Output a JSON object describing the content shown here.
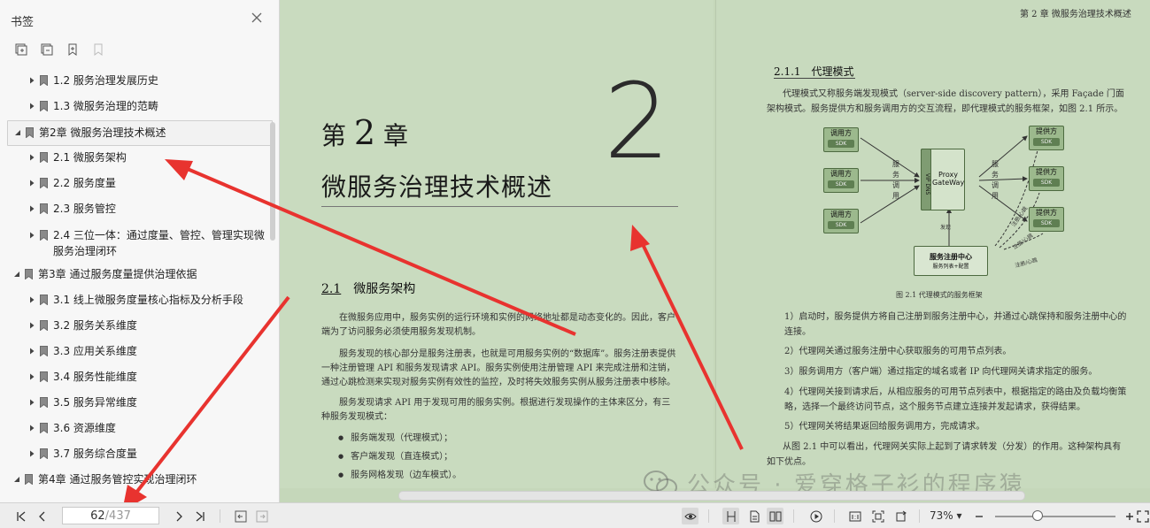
{
  "panel": {
    "title": "书签",
    "items": [
      {
        "label": "1.2  服务治理发展历史",
        "level": 1,
        "expanded": false
      },
      {
        "label": "1.3  微服务治理的范畴",
        "level": 1,
        "expanded": false
      },
      {
        "label": "第2章  微服务治理技术概述",
        "level": 0,
        "expanded": true
      },
      {
        "label": "2.1  微服务架构",
        "level": 1,
        "expanded": false
      },
      {
        "label": "2.2  服务度量",
        "level": 1,
        "expanded": false
      },
      {
        "label": "2.3  服务管控",
        "level": 1,
        "expanded": false
      },
      {
        "label": "2.4  三位一体：通过度量、管控、管理实现微服务治理闭环",
        "level": 1,
        "expanded": false
      },
      {
        "label": "第3章  通过服务度量提供治理依据",
        "level": 0,
        "expanded": true
      },
      {
        "label": "3.1  线上微服务度量核心指标及分析手段",
        "level": 1,
        "expanded": false
      },
      {
        "label": "3.2  服务关系维度",
        "level": 1,
        "expanded": false
      },
      {
        "label": "3.3  应用关系维度",
        "level": 1,
        "expanded": false
      },
      {
        "label": "3.4  服务性能维度",
        "level": 1,
        "expanded": false
      },
      {
        "label": "3.5  服务异常维度",
        "level": 1,
        "expanded": false
      },
      {
        "label": "3.6  资源维度",
        "level": 1,
        "expanded": false
      },
      {
        "label": "3.7  服务综合度量",
        "level": 1,
        "expanded": false
      },
      {
        "label": "第4章  通过服务管控实现治理闭环",
        "level": 0,
        "expanded": true
      }
    ]
  },
  "left_page": {
    "chapter_prefix": "第",
    "chapter_number": "2",
    "chapter_suffix": "章",
    "big_number": "2",
    "chapter_title": "微服务治理技术概述",
    "section_number": "2.1",
    "section_title": "微服务架构",
    "paragraphs": [
      "在微服务应用中，服务实例的运行环境和实例的网络地址都是动态变化的。因此，客户端为了访问服务必须使用服务发现机制。",
      "服务发现的核心部分是服务注册表，也就是可用服务实例的“数据库”。服务注册表提供一种注册管理 API 和服务发现请求 API。服务实例使用注册管理 API 来完成注册和注销，通过心跳检测来实现对服务实例有效性的监控，及时将失效服务实例从服务注册表中移除。",
      "服务发现请求 API 用于发现可用的服务实例。根据进行发现操作的主体来区分，有三种服务发现模式："
    ],
    "bullets": [
      "服务端发现（代理模式）；",
      "客户端发现（直连模式）；",
      "服务网格发现（边车模式）。"
    ]
  },
  "right_page": {
    "running_head": "第 2 章  微服务治理技术概述",
    "section_number": "2.1.1",
    "section_title": "代理模式",
    "intro": "代理模式又称服务端发现模式（server-side discovery pattern），采用 Façade 门面架构模式。服务提供方和服务调用方的交互流程，即代理模式的服务框架，如图 2.1 所示。",
    "figure": {
      "caller": "调用方",
      "provider": "提供方",
      "sdk": "SDK",
      "proxy": "Proxy\nGateWay",
      "vip": "VIP  DNS",
      "call_left": "服\n务\n调\n用",
      "call_right": "服\n务\n调\n用",
      "register": "服务注册中心",
      "register_sub": "服务列表+配置",
      "discover": "发现",
      "heartbeat": "注册/心跳"
    },
    "caption": "图 2.1   代理模式的服务框架",
    "items": [
      "1）启动时，服务提供方将自己注册到服务注册中心，并通过心跳保持和服务注册中心的连接。",
      "2）代理网关通过服务注册中心获取服务的可用节点列表。",
      "3）服务调用方（客户端）通过指定的域名或者 IP 向代理网关请求指定的服务。",
      "4）代理网关接到请求后，从相应服务的可用节点列表中，根据指定的路由及负载均衡策略，选择一个最终访问节点，这个服务节点建立连接并发起请求，获得结果。",
      "5）代理网关将结果返回给服务调用方，完成请求。"
    ],
    "outro": "从图 2.1 中可以看出，代理网关实际上起到了请求转发（分发）的作用。这种架构具有如下优点。"
  },
  "watermark": {
    "text": "公众号 · 爱穿格子衫的程序猿"
  },
  "toolbar": {
    "current_page": "62",
    "total_pages": "/437",
    "zoom": "73%"
  }
}
